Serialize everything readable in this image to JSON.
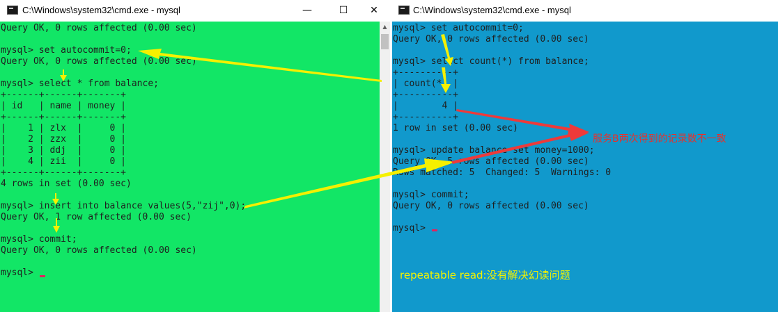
{
  "colors": {
    "left_console_bg": "#12e666",
    "right_console_bg": "#1199cc",
    "console_text": "#1f1f1f",
    "cursor": "#e0245e",
    "arrow_yellow": "#f5f000",
    "arrow_red": "#ee3a3a",
    "annotation_red": "#e8302a",
    "annotation_yellow": "#f2f200"
  },
  "left_window": {
    "title": "C:\\Windows\\system32\\cmd.exe - mysql",
    "icon": "cmd-icon",
    "buttons": {
      "minimize": "—",
      "maximize": "☐",
      "close": "✕"
    },
    "lines": [
      "Query OK, 0 rows affected (0.00 sec)",
      "",
      "mysql> set autocommit=0;",
      "Query OK, 0 rows affected (0.00 sec)",
      "",
      "mysql> select * from balance;",
      "+------+------+-------+",
      "| id   | name | money |",
      "+------+------+-------+",
      "|    1 | zlx  |     0 |",
      "|    2 | zzx  |     0 |",
      "|    3 | ddj  |     0 |",
      "|    4 | zii  |     0 |",
      "+------+------+-------+",
      "4 rows in set (0.00 sec)",
      "",
      "mysql> insert into balance values(5,\"zij\",0);",
      "Query OK, 1 row affected (0.00 sec)",
      "",
      "mysql> commit;",
      "Query OK, 0 rows affected (0.00 sec)",
      "",
      "mysql> "
    ]
  },
  "right_window": {
    "title": "C:\\Windows\\system32\\cmd.exe - mysql",
    "icon": "cmd-icon",
    "lines": [
      "mysql> set autocommit=0;",
      "Query OK, 0 rows affected (0.00 sec)",
      "",
      "mysql> select count(*) from balance;",
      "+----------+",
      "| count(*) |",
      "+----------+",
      "|        4 |",
      "+----------+",
      "1 row in set (0.00 sec)",
      "",
      "mysql> update balance set money=1000;",
      "Query OK, 5 rows affected (0.00 sec)",
      "Rows matched: 5  Changed: 5  Warnings: 0",
      "",
      "mysql> commit;",
      "Query OK, 0 rows affected (0.00 sec)",
      "",
      "mysql> "
    ]
  },
  "annotations": {
    "red_note": "服务B两次得到的记录数不一致",
    "yellow_note": "repeatable read:没有解决幻读问题"
  }
}
